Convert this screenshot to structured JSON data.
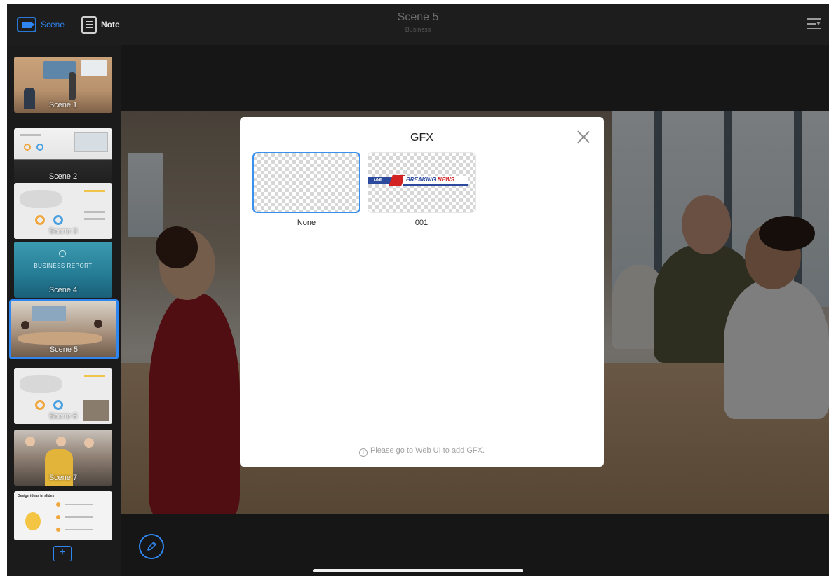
{
  "header": {
    "scene_button_label": "Scene",
    "note_button_label": "Note",
    "title": "Scene 5",
    "subtitle": "Business"
  },
  "sidebar": {
    "scenes": [
      {
        "label": "Scene 1"
      },
      {
        "label": "Scene 2"
      },
      {
        "label": "Scene 3"
      },
      {
        "label": "Scene 4",
        "thumb_text": "BUSINESS REPORT"
      },
      {
        "label": "Scene 5",
        "active": true
      },
      {
        "label": "Scene 6"
      },
      {
        "label": "Scene 7"
      },
      {
        "label": "",
        "thumb_text": "Design ideas in slides"
      }
    ],
    "add_icon": "+"
  },
  "modal": {
    "title": "GFX",
    "items": [
      {
        "name": "None",
        "selected": true
      },
      {
        "name": "001",
        "graphic_live": "LIVE",
        "graphic_breaking": "BREAKING",
        "graphic_news": "NEWS"
      }
    ],
    "footer": "Please go to Web UI to add GFX.",
    "info_glyph": "i"
  },
  "colors": {
    "accent": "#2f86f0",
    "background": "#161616",
    "modal_bg": "#ffffff"
  },
  "icons": [
    "camera-icon",
    "note-icon",
    "menu-icon",
    "close-icon",
    "info-icon",
    "pencil-icon",
    "add-icon"
  ]
}
